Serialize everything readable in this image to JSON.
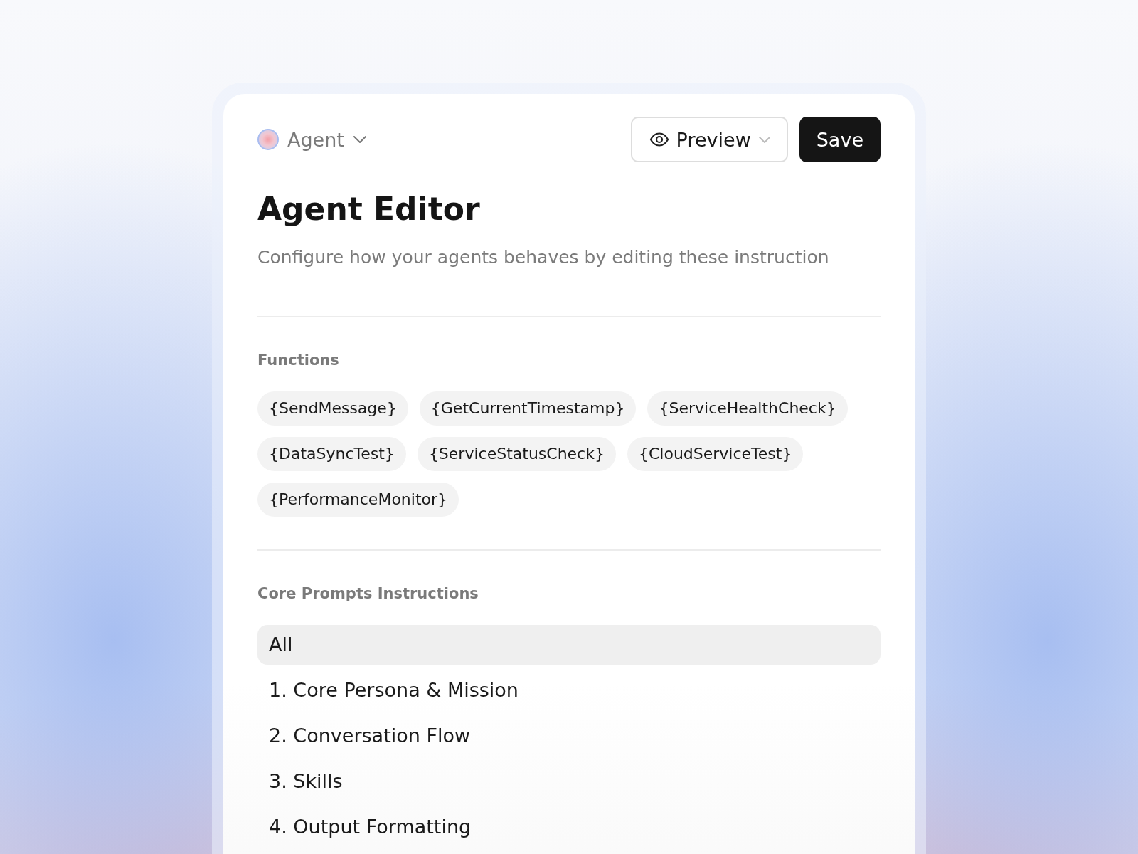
{
  "header": {
    "agent_selector": {
      "label": "Agent"
    },
    "preview_button": {
      "label": "Preview"
    },
    "save_button": {
      "label": "Save"
    }
  },
  "title": "Agent Editor",
  "subtitle": "Configure how your agents behaves by editing these instruction",
  "functions": {
    "heading": "Functions",
    "chips": [
      "{SendMessage}",
      "{GetCurrentTimestamp}",
      "{ServiceHealthCheck}",
      "{DataSyncTest}",
      "{ServiceStatusCheck}",
      "{CloudServiceTest}",
      "{PerformanceMonitor}"
    ]
  },
  "core_prompts": {
    "heading": "Core Prompts Instructions",
    "items": [
      {
        "label": "All",
        "selected": true
      },
      {
        "label": "1. Core Persona & Mission",
        "selected": false
      },
      {
        "label": "2. Conversation Flow",
        "selected": false
      },
      {
        "label": "3. Skills",
        "selected": false
      },
      {
        "label": "4. Output Formatting",
        "selected": false
      }
    ]
  }
}
